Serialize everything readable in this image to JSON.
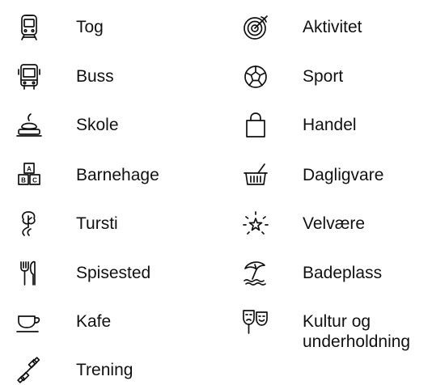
{
  "legend": {
    "left": [
      {
        "label": "Tog",
        "icon": "train-icon"
      },
      {
        "label": "Buss",
        "icon": "bus-icon"
      },
      {
        "label": "Skole",
        "icon": "school-icon"
      },
      {
        "label": "Barnehage",
        "icon": "kindergarten-blocks-icon"
      },
      {
        "label": "Tursti",
        "icon": "hiking-trail-icon"
      },
      {
        "label": "Spisested",
        "icon": "restaurant-cutlery-icon"
      },
      {
        "label": "Kafe",
        "icon": "coffee-cup-icon"
      },
      {
        "label": "Trening",
        "icon": "dumbbell-icon"
      }
    ],
    "right": [
      {
        "label": "Aktivitet",
        "icon": "target-icon"
      },
      {
        "label": "Sport",
        "icon": "soccer-ball-icon"
      },
      {
        "label": "Handel",
        "icon": "shopping-bag-icon"
      },
      {
        "label": "Dagligvare",
        "icon": "grocery-basket-icon"
      },
      {
        "label": "Velvære",
        "icon": "wellness-star-icon"
      },
      {
        "label": "Badeplass",
        "icon": "beach-umbrella-icon"
      },
      {
        "label": "Kultur og underholdning",
        "icon": "theater-masks-icon"
      }
    ]
  }
}
